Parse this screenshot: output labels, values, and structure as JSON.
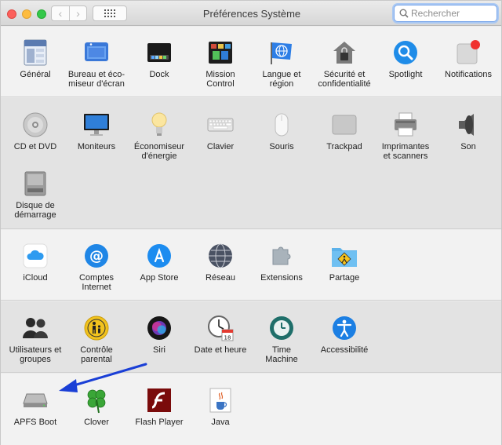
{
  "window": {
    "title": "Préférences Système"
  },
  "toolbar": {
    "back": "‹",
    "forward": "›"
  },
  "search": {
    "placeholder": "Rechercher"
  },
  "sections": [
    {
      "items": [
        {
          "label": "Général"
        },
        {
          "label": "Bureau et éco-\nmiseur d'écran"
        },
        {
          "label": "Dock"
        },
        {
          "label": "Mission\nControl"
        },
        {
          "label": "Langue et\nrégion"
        },
        {
          "label": "Sécurité et\nconfidentialité"
        },
        {
          "label": "Spotlight"
        },
        {
          "label": "Notifications"
        }
      ]
    },
    {
      "items": [
        {
          "label": "CD et DVD"
        },
        {
          "label": "Moniteurs"
        },
        {
          "label": "Économiseur\nd'énergie"
        },
        {
          "label": "Clavier"
        },
        {
          "label": "Souris"
        },
        {
          "label": "Trackpad"
        },
        {
          "label": "Imprimantes\net scanners"
        },
        {
          "label": "Son"
        },
        {
          "label": "Disque de\ndémarrage"
        }
      ]
    },
    {
      "items": [
        {
          "label": "iCloud"
        },
        {
          "label": "Comptes\nInternet"
        },
        {
          "label": "App Store"
        },
        {
          "label": "Réseau"
        },
        {
          "label": "Extensions"
        },
        {
          "label": "Partage"
        }
      ]
    },
    {
      "items": [
        {
          "label": "Utilisateurs et\ngroupes"
        },
        {
          "label": "Contrôle\nparental"
        },
        {
          "label": "Siri"
        },
        {
          "label": "Date et heure"
        },
        {
          "label": "Time\nMachine"
        },
        {
          "label": "Accessibilité"
        }
      ]
    },
    {
      "items": [
        {
          "label": "APFS Boot"
        },
        {
          "label": "Clover"
        },
        {
          "label": "Flash Player"
        },
        {
          "label": "Java"
        }
      ]
    }
  ],
  "icons": {
    "general": "file-icon",
    "desktop": "desktop-screensaver-icon",
    "dock": "dock-icon",
    "mission": "mission-control-icon",
    "language": "flag-globe-icon",
    "security": "house-lock-icon",
    "spotlight": "magnifier-icon",
    "notifications": "notification-badge-icon",
    "cd": "disc-icon",
    "displays": "monitor-icon",
    "energy": "light-bulb-icon",
    "keyboard": "keyboard-icon",
    "mouse": "mouse-icon",
    "trackpad": "trackpad-icon",
    "printers": "printer-icon",
    "sound": "speaker-icon",
    "startup": "hard-disk-icon",
    "icloud": "cloud-icon",
    "accounts": "at-sign-icon",
    "appstore": "app-store-icon",
    "network": "globe-network-icon",
    "extensions": "puzzle-icon",
    "sharing": "folder-warning-icon",
    "users": "users-silhouette-icon",
    "parental": "parental-controls-icon",
    "siri": "siri-icon",
    "datetime": "clock-calendar-icon",
    "timemachine": "time-machine-icon",
    "accessibility": "accessibility-icon",
    "apfs": "drive-icon",
    "clover": "clover-leaf-icon",
    "flash": "flash-player-icon",
    "java": "java-cup-icon"
  },
  "colors": {
    "annotation_arrow": "#1a3fd6",
    "search_focus": "#7aa7ea"
  }
}
